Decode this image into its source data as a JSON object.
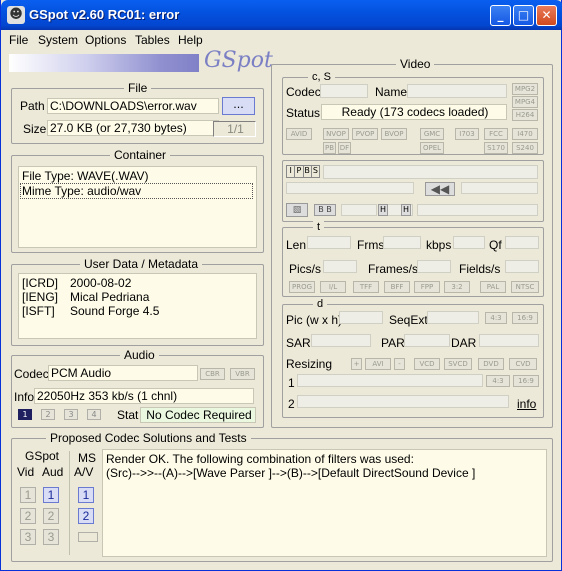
{
  "window": {
    "title": "GSpot v2.60 RC01: error",
    "app_icon": "gspot-icon"
  },
  "title_buttons": {
    "minimize": "_",
    "maximize": "□",
    "close": "✕"
  },
  "menu": [
    "File",
    "System",
    "Options",
    "Tables",
    "Help"
  ],
  "logo": "GSpot",
  "file": {
    "title": "File",
    "path_label": "Path",
    "path_value": "C:\\DOWNLOADS\\error.wav",
    "browse_label": "...",
    "size_label": "Size",
    "size_value": "27.0 KB (or 27,730 bytes)",
    "part_value": "1/1"
  },
  "container": {
    "title": "Container",
    "lines": [
      "File Type: WAVE(.WAV)",
      "Mime Type: audio/wav"
    ]
  },
  "metadata": {
    "title": "User Data / Metadata",
    "rows": [
      {
        "key": "[ICRD]",
        "value": "2000-08-02"
      },
      {
        "key": "[IENG]",
        "value": "Mical Pedriana"
      },
      {
        "key": "[ISFT]",
        "value": "Sound Forge 4.5"
      }
    ]
  },
  "audio": {
    "title": "Audio",
    "codec_label": "Codec",
    "codec_value": "PCM Audio",
    "cbr": "CBR",
    "vbr": "VBR",
    "info_label": "Info",
    "info_value": "22050Hz  353 kb/s (1 chnl)",
    "streams": [
      "1",
      "2",
      "3",
      "4"
    ],
    "stat_label": "Stat",
    "stat_value": "No Codec Required"
  },
  "video": {
    "title": "Video",
    "cs_label": "c, S",
    "codec_label": "Codec",
    "name_label": "Name",
    "status_label": "Status",
    "status_value": "Ready (173 codecs loaded)",
    "fmt_buttons": [
      "MPG2",
      "MPG4",
      "H264"
    ],
    "row_buttons_a": [
      "AVID",
      "NVOP",
      "PVOP",
      "BVOP",
      "GMC",
      "I703",
      "FCC",
      "I470"
    ],
    "row_buttons_b": [
      "PB",
      "DF",
      "OPEL",
      "S170",
      "S240"
    ],
    "frame_types": [
      "I",
      "P",
      "B",
      "S"
    ],
    "t_label": "t",
    "len_label": "Len",
    "frms_label": "Frms",
    "kbps_label": "kbps",
    "qf_label": "Qf",
    "pics_label": "Pics/s",
    "frames_label": "Frames/s",
    "fields_label": "Fields/s",
    "t_buttons": [
      "PROG",
      "I/L",
      "TFF",
      "BFF",
      "FPP",
      "3:2",
      "PAL",
      "NTSC"
    ],
    "d_label": "d",
    "pic_label": "Pic (w x h)",
    "seqext_label": "SeqExt",
    "ratio_43": "4:3",
    "ratio_169": "16:9",
    "sar_label": "SAR",
    "par_label": "PAR",
    "dar_label": "DAR",
    "resizing_label": "Resizing",
    "resize_buttons": [
      "+",
      "AVI",
      "-",
      "VCD",
      "SVCD",
      "DVD",
      "CVD"
    ],
    "row1_label": "1",
    "row2_label": "2",
    "info_link": "info"
  },
  "proposed": {
    "title": "Proposed Codec Solutions and Tests",
    "gspot_label": "GSpot",
    "vid_label": "Vid",
    "aud_label": "Aud",
    "ms_label": "MS",
    "av_label": "A/V",
    "numbers": [
      "1",
      "2",
      "3"
    ],
    "lines": [
      "Render OK. The following combination of filters was used:",
      "(Src)-->>--(A)-->[Wave Parser ]-->(B)-->[Default DirectSound Device ]"
    ]
  }
}
